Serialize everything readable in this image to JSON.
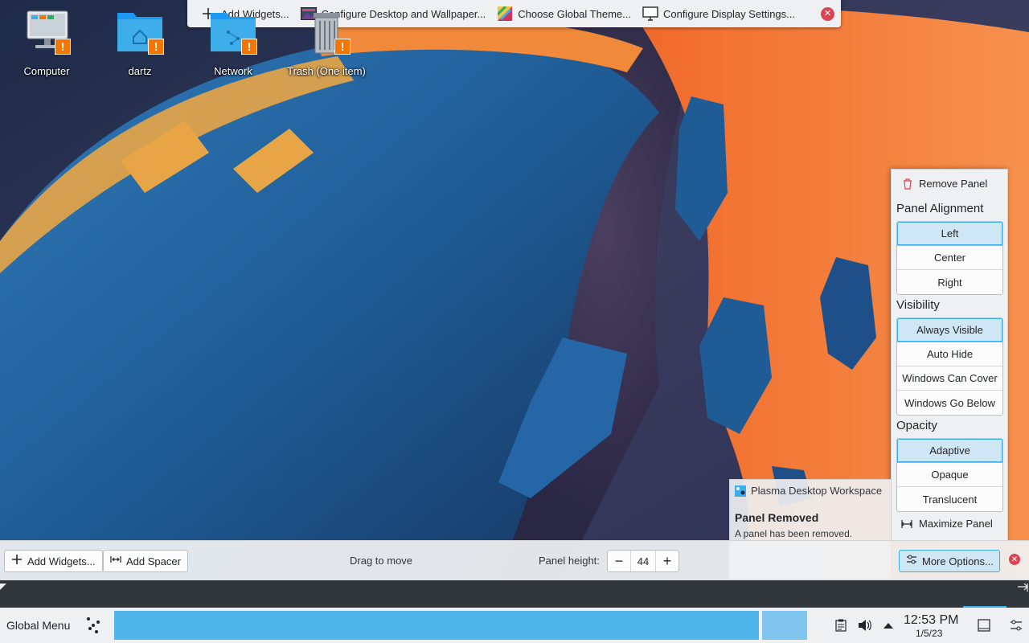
{
  "desktop_toolbar": {
    "items": [
      {
        "label": "Add Widgets...",
        "icon": "plus-icon"
      },
      {
        "label": "Configure Desktop and Wallpaper...",
        "icon": "wallpaper-icon"
      },
      {
        "label": "Choose Global Theme...",
        "icon": "theme-icon"
      },
      {
        "label": "Configure Display Settings...",
        "icon": "display-icon"
      }
    ]
  },
  "desktop_icons": [
    {
      "label": "Computer",
      "icon": "computer-icon"
    },
    {
      "label": "dartz",
      "icon": "home-folder-icon"
    },
    {
      "label": "Network",
      "icon": "network-folder-icon"
    },
    {
      "label": "Trash (One item)",
      "icon": "trash-icon"
    }
  ],
  "panel_options": {
    "remove_panel": "Remove Panel",
    "alignment": {
      "heading": "Panel Alignment",
      "options": [
        "Left",
        "Center",
        "Right"
      ],
      "selected": "Left"
    },
    "visibility": {
      "heading": "Visibility",
      "options": [
        "Always Visible",
        "Auto Hide",
        "Windows Can Cover",
        "Windows Go Below"
      ],
      "selected": "Always Visible"
    },
    "opacity": {
      "heading": "Opacity",
      "options": [
        "Adaptive",
        "Opaque",
        "Translucent"
      ],
      "selected": "Adaptive"
    },
    "maximize_panel": "Maximize Panel"
  },
  "notification": {
    "app": "Plasma Desktop Workspace",
    "title": "Panel Removed",
    "body": "A panel has been removed."
  },
  "panel_edit": {
    "add_widgets": "Add Widgets...",
    "add_spacer": "Add Spacer",
    "drag_hint": "Drag to move",
    "height_label": "Panel height:",
    "height_value": "44",
    "decrement": "−",
    "increment": "+",
    "more_options": "More Options..."
  },
  "taskbar": {
    "global_menu": "Global Menu",
    "time": "12:53 PM",
    "date": "1/5/23"
  },
  "colors": {
    "accent": "#3daee9",
    "warning": "#f67400",
    "close": "#da4453"
  }
}
